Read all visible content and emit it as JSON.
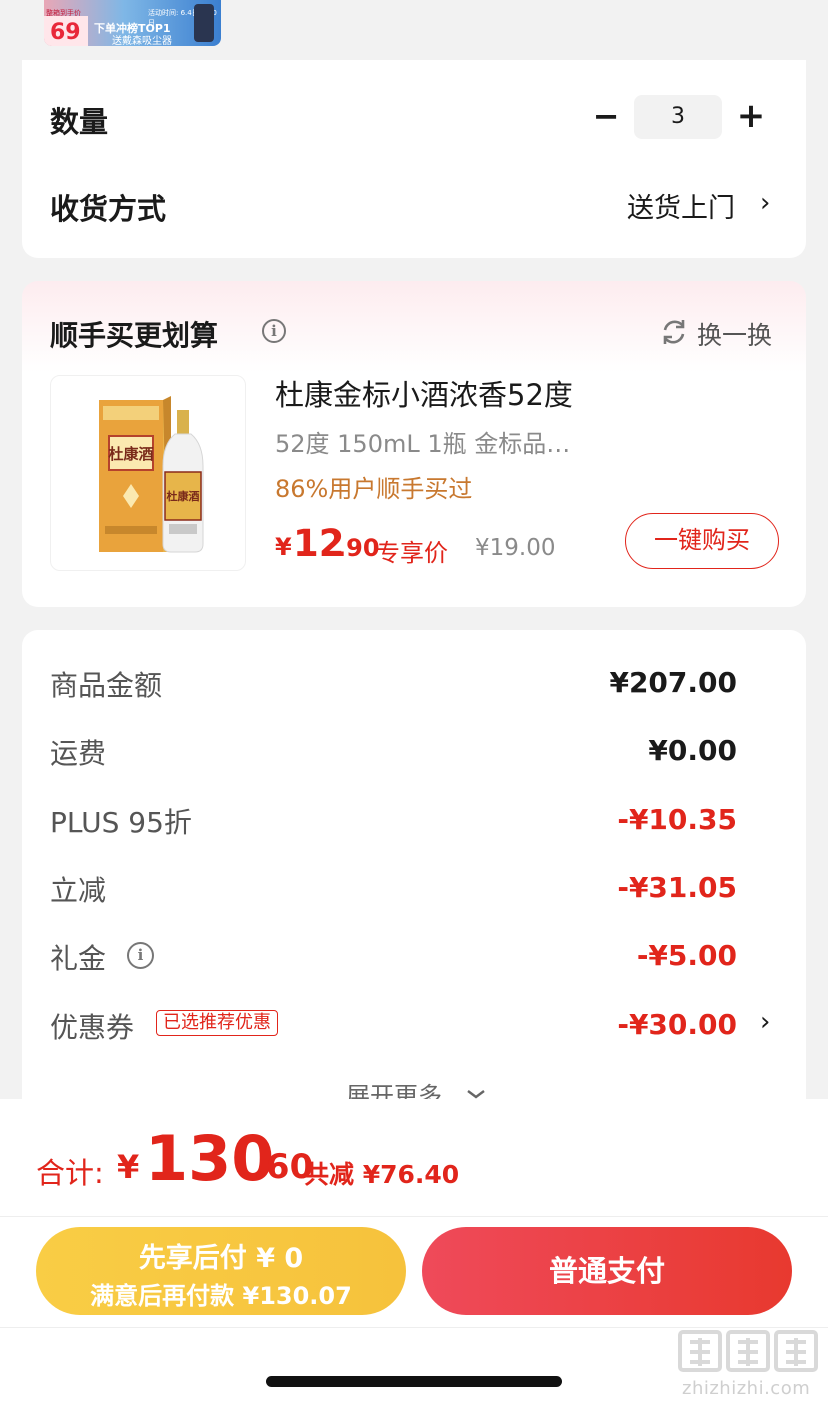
{
  "banner": {
    "price_small": "69",
    "price_prefix_label": "整箱到手价",
    "line1": "下单冲榜TOP1",
    "line2": "送戴森吸尘器",
    "date_label": "活动时间: 6.4日-6.20日"
  },
  "order": {
    "quantity_label": "数量",
    "quantity_value": "3",
    "minus_symbol": "−",
    "plus_symbol": "+",
    "delivery_label": "收货方式",
    "delivery_value": "送货上门",
    "chevron": "›"
  },
  "addon": {
    "title": "顺手买更划算",
    "swap_label": "换一换",
    "product": {
      "name": "杜康金标小酒浓香52度",
      "spec": "52度 150mL 1瓶 金标品…",
      "stat": "86%用户顺手买过",
      "price_yen": "¥",
      "price_int": "12",
      "price_dec": ".90",
      "price_tag": "专享价",
      "original_price": "¥19.00",
      "bottle_label": "杜康酒",
      "buy_button": "一键购买"
    }
  },
  "summary": {
    "rows": [
      {
        "label": "商品金额",
        "value": "¥207.00"
      },
      {
        "label": "运费",
        "value": "¥0.00"
      },
      {
        "label": "PLUS 95折",
        "value": "-¥10.35"
      },
      {
        "label": "立减",
        "value": "-¥31.05"
      },
      {
        "label": "礼金",
        "value": "-¥5.00"
      },
      {
        "label": "优惠券",
        "value": "-¥30.00"
      }
    ],
    "coupon_tag": "已选推荐优惠",
    "expand_label": "展开更多"
  },
  "checkout": {
    "total_label": "合计:",
    "total_yen": "¥",
    "total_int": "130",
    "total_dec": ".60",
    "saved_label": "共减 ¥76.40",
    "pay_later_line1": "先享后付 ¥ 0",
    "pay_later_line2": "满意后再付款 ¥130.07",
    "pay_normal": "普通支付"
  },
  "watermark": {
    "text": "zhizhizhi.com",
    "logo": "值值值"
  },
  "colors": {
    "accent_red": "#e1251b",
    "gold": "#c8782f",
    "pay_later_yellow": "#f6c23c",
    "pay_normal_red": "#e8392f"
  }
}
